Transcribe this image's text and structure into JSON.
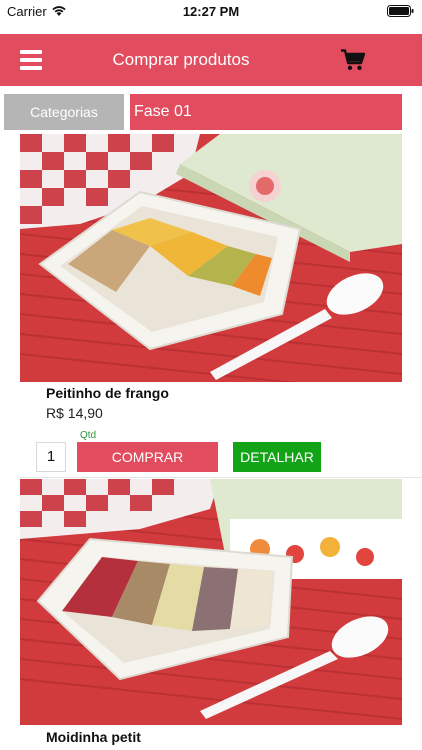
{
  "status_bar": {
    "carrier": "Carrier",
    "time": "12:27 PM"
  },
  "nav": {
    "title": "Comprar produtos",
    "menu_icon": "hamburger-menu-icon",
    "cart_icon": "shopping-cart-icon"
  },
  "filters": {
    "categories_label": "Categorias",
    "selected_phase": "Fase 01"
  },
  "colors": {
    "brand_red": "#e14c5f",
    "detail_green": "#12a317",
    "categories_gray": "#b5b5b5"
  },
  "products": [
    {
      "name": "Peitinho de frango",
      "price": "R$ 14,90",
      "qty_caption": "Qtd",
      "qty_value": "1",
      "buy_label": "COMPRAR",
      "detail_label": "DETALHAR",
      "image": "baby-food-tray-photo"
    },
    {
      "name": "Moidinha petit",
      "image": "baby-food-tray-photo"
    }
  ]
}
